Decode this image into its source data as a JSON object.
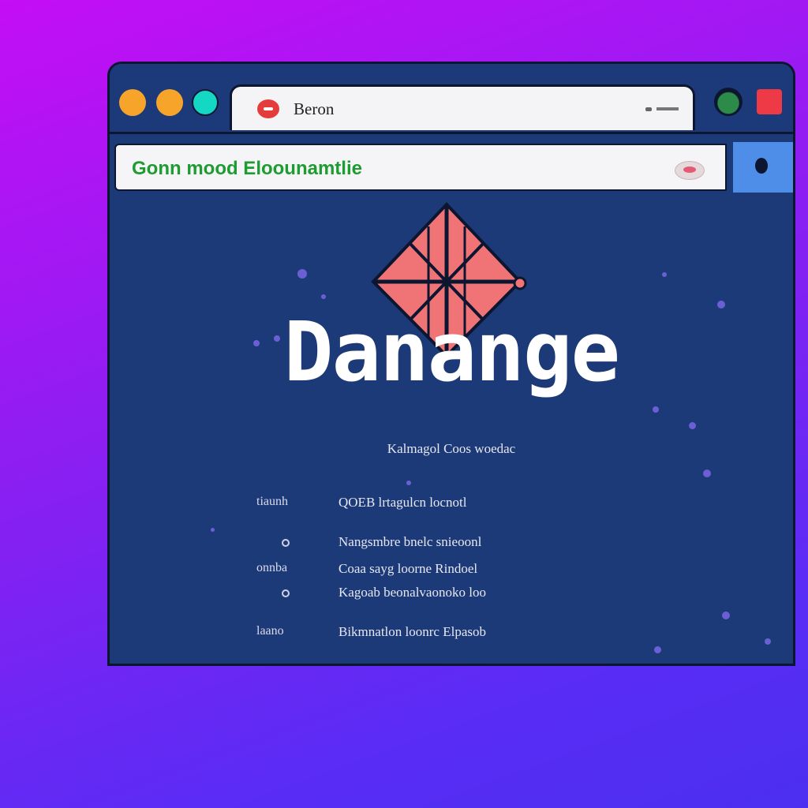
{
  "tab": {
    "title": "Beron"
  },
  "address": {
    "value": "Gonn mood Eloounamtlie"
  },
  "hero": {
    "title": "Danange"
  },
  "content": {
    "subtitle": "Kalmagol Coos woedac",
    "rows": [
      {
        "label": "tiaunh",
        "value": "QOEB lrtagulcn locnotl"
      },
      {
        "label": "",
        "value": "Nangsmbre bnelc snieoonl"
      },
      {
        "label": "onnba",
        "value": "Coaa sayg loorne Rindoel"
      },
      {
        "label": "",
        "value": "Kagoab beonalvaonoko loo"
      },
      {
        "label": "laano",
        "value": "Bikmnatlon loonrc  Elpasob"
      }
    ]
  },
  "colors": {
    "background_top": "#c40ef5",
    "background_bottom": "#4b2ff0",
    "window": "#1d3a78",
    "accent_red": "#e43b3b",
    "url_text": "#1e9b31",
    "logo_fill": "#f07476"
  },
  "icons": {
    "tab_favicon": "red-circle-icon",
    "logo": "diamond-logo-icon",
    "menu": "menu-icon",
    "extension": "extension-icon"
  }
}
